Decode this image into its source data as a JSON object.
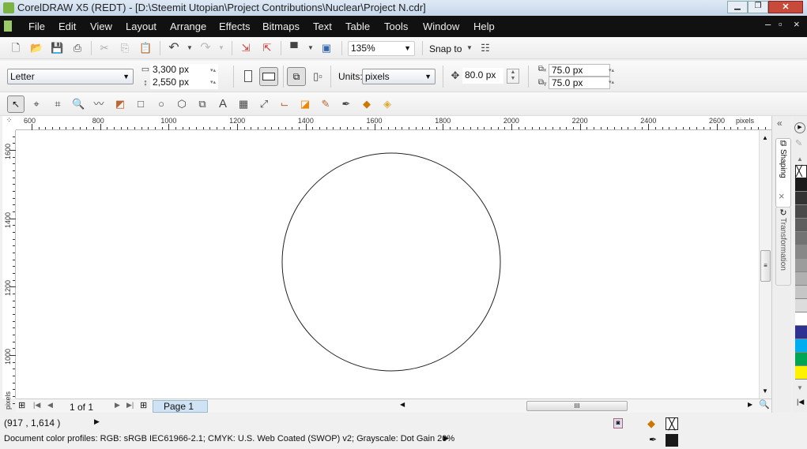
{
  "window": {
    "title": "CorelDRAW X5 (REDT) - [D:\\Steemit Utopian\\Project Contributions\\Nuclear\\Project N.cdr]"
  },
  "menu": [
    "File",
    "Edit",
    "View",
    "Layout",
    "Arrange",
    "Effects",
    "Bitmaps",
    "Text",
    "Table",
    "Tools",
    "Window",
    "Help"
  ],
  "standard_toolbar": {
    "zoom": "135%",
    "snap_to": "Snap to"
  },
  "property_bar": {
    "page_size": "Letter",
    "width": "3,300 px",
    "height": "2,550 px",
    "units_label": "Units:",
    "units": "pixels",
    "nudge": "80.0 px",
    "dup_x": "75.0 px",
    "dup_y": "75.0 px"
  },
  "toolbox": [
    "pick-tool",
    "shape-tool",
    "crop-tool",
    "zoom-tool",
    "freehand-tool",
    "smart-fill-tool",
    "rectangle-tool",
    "ellipse-tool",
    "polygon-tool",
    "basic-shapes-tool",
    "text-tool",
    "table-tool",
    "dimension-tool",
    "connector-tool",
    "blend-tool",
    "eyedropper-tool",
    "outline-tool",
    "fill-tool",
    "interactive-fill-tool"
  ],
  "rulers": {
    "unit": "pixels",
    "h_ticks": [
      "600",
      "800",
      "1000",
      "1200",
      "1400",
      "1600",
      "1800",
      "2000",
      "2200",
      "2400",
      "2600"
    ],
    "v_ticks": [
      "1600",
      "1400",
      "1200",
      "1000"
    ],
    "v_unit": "pixels"
  },
  "pages": {
    "counter": "1 of 1",
    "tab": "Page 1"
  },
  "status": {
    "coords": "(917  , 1,614 )",
    "profiles": "Document color profiles: RGB: sRGB IEC61966-2.1; CMYK: U.S. Web Coated (SWOP) v2; Grayscale: Dot Gain 20%"
  },
  "dockers": [
    "Shaping",
    "Transformation"
  ],
  "palette": [
    "none",
    "#1a1a1a",
    "#333333",
    "#4a4a4a",
    "#5e5e5e",
    "#737373",
    "#888888",
    "#9c9c9c",
    "#b0b0b0",
    "#c6c6c6",
    "#dcdcdc",
    "#ffffff",
    "#2e3192",
    "#00aeef",
    "#00a651",
    "#fff200"
  ]
}
